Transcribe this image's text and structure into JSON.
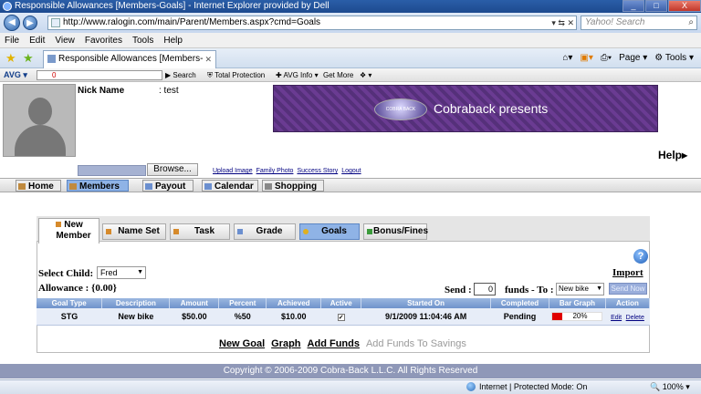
{
  "window": {
    "title": "Responsible Allowances [Members-Goals] - Internet Explorer provided by Dell",
    "controls": {
      "minimize": "_",
      "maximize": "□",
      "close": "X"
    }
  },
  "browser": {
    "address": "http://www.ralogin.com/main/Parent/Members.aspx?cmd=Goals",
    "search_placeholder": "Yahoo! Search",
    "menu": [
      "File",
      "Edit",
      "View",
      "Favorites",
      "Tools",
      "Help"
    ],
    "tab_title": "Responsible Allowances [Members-Go...",
    "right_tools": {
      "page": "Page",
      "tools": "Tools"
    },
    "avg_toolbar": {
      "logo": "AVG",
      "search_value": "0",
      "search_button": "Search",
      "total_protection": "Total Protection",
      "avg_info": "AVG Info",
      "get_more": "Get More"
    }
  },
  "profile": {
    "nick_label": "Nick Name",
    "nick_value": ": test",
    "browse_label": "Browse...",
    "links": [
      "Upload Image",
      "Family Photo",
      "Success Story",
      "Logout"
    ],
    "help_label": "Help"
  },
  "banner": {
    "text": "Cobraback presents",
    "logo_text": "COBRA BACK"
  },
  "main_nav": [
    "Home",
    "Members",
    "Payout",
    "Calendar",
    "Shopping"
  ],
  "sub_tabs": {
    "new_member_line1": "New",
    "new_member_line2": "Member",
    "name_set": "Name Set",
    "task": "Task",
    "grade": "Grade",
    "goals": "Goals",
    "bonus": "Bonus/Fines"
  },
  "goals_page": {
    "help_icon": "?",
    "import_label": "Import",
    "select_child_label": "Select Child:",
    "selected_child": "Fred",
    "allowance_label": "Allowance : {0.00}",
    "send_label": "Send :",
    "send_value": "0",
    "funds_to_label": "funds - To :",
    "funds_to_value": "New bike",
    "send_now_label": "Send Now"
  },
  "table": {
    "headers": [
      "Goal Type",
      "Description",
      "Amount",
      "Percent",
      "Achieved",
      "Active",
      "Started On",
      "Completed",
      "Bar Graph",
      "Action"
    ],
    "rows": [
      {
        "goal_type": "STG",
        "description": "New bike",
        "amount": "$50.00",
        "percent": "%50",
        "achieved": "$10.00",
        "active_mark": "✓",
        "started_on": "9/1/2009 11:04:46 AM",
        "completed": "Pending",
        "bar_graph_text": "20%",
        "bar_graph_fraction": 0.2,
        "edit": "Edit",
        "delete": "Delete"
      }
    ]
  },
  "bottom_links": {
    "new_goal": "New Goal",
    "graph": "Graph",
    "add_funds": "Add Funds",
    "add_to_savings": "Add Funds To Savings"
  },
  "footer": {
    "copyright": "Copyright © 2006-2009 Cobra-Back L.L.C. All Rights Reserved"
  },
  "status": {
    "zone": "Internet | Protected Mode: On",
    "zoom": "100%"
  },
  "colors": {
    "accent_blue": "#8fb3e6",
    "bar_fill": "#e00000",
    "footer": "#8f98b8"
  }
}
